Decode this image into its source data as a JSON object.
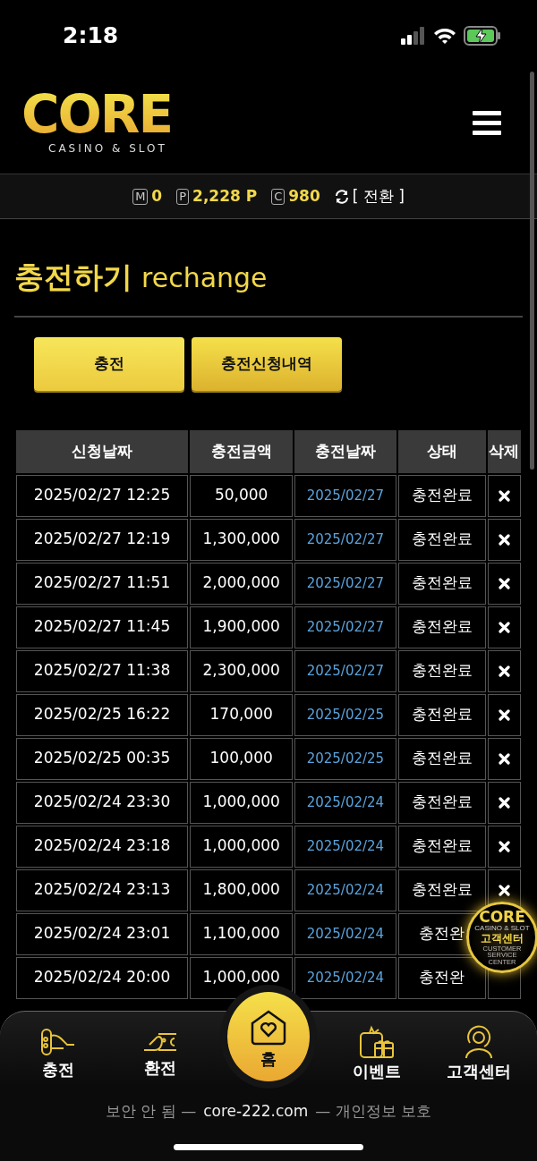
{
  "status_bar": {
    "time": "2:18"
  },
  "header": {
    "logo": {
      "name": "CORE",
      "tagline": "CASINO & SLOT"
    }
  },
  "balance": {
    "items": [
      {
        "symbol": "M",
        "value": "0"
      },
      {
        "symbol": "P",
        "value": "2,228 P"
      },
      {
        "symbol": "C",
        "value": "980"
      }
    ],
    "convert": "[ 전환 ]"
  },
  "page_title": {
    "title": "충전하기",
    "subtitle": "rechange"
  },
  "tabs": [
    {
      "label": "충전",
      "selected": false
    },
    {
      "label": "충전신청내역",
      "selected": true
    }
  ],
  "table": {
    "columns": [
      "신청날짜",
      "충전금액",
      "충전날짜",
      "상태",
      "삭제"
    ],
    "rows": [
      {
        "requested": "2025/02/27 12:25",
        "amount": "50,000",
        "charged": "2025/02/27",
        "status": "충전완료"
      },
      {
        "requested": "2025/02/27 12:19",
        "amount": "1,300,000",
        "charged": "2025/02/27",
        "status": "충전완료"
      },
      {
        "requested": "2025/02/27 11:51",
        "amount": "2,000,000",
        "charged": "2025/02/27",
        "status": "충전완료"
      },
      {
        "requested": "2025/02/27 11:45",
        "amount": "1,900,000",
        "charged": "2025/02/27",
        "status": "충전완료"
      },
      {
        "requested": "2025/02/27 11:38",
        "amount": "2,300,000",
        "charged": "2025/02/27",
        "status": "충전완료"
      },
      {
        "requested": "2025/02/25 16:22",
        "amount": "170,000",
        "charged": "2025/02/25",
        "status": "충전완료"
      },
      {
        "requested": "2025/02/25 00:35",
        "amount": "100,000",
        "charged": "2025/02/25",
        "status": "충전완료"
      },
      {
        "requested": "2025/02/24 23:30",
        "amount": "1,000,000",
        "charged": "2025/02/24",
        "status": "충전완료"
      },
      {
        "requested": "2025/02/24 23:18",
        "amount": "1,000,000",
        "charged": "2025/02/24",
        "status": "충전완료"
      },
      {
        "requested": "2025/02/24 23:13",
        "amount": "1,800,000",
        "charged": "2025/02/24",
        "status": "충전완료"
      },
      {
        "requested": "2025/02/24 23:01",
        "amount": "1,100,000",
        "charged": "2025/02/24",
        "status": "충전완"
      },
      {
        "requested": "2025/02/24 20:00",
        "amount": "1,000,000",
        "charged": "2025/02/24",
        "status": "충전완"
      }
    ]
  },
  "support_badge": {
    "logo": "CORE",
    "tagline": "CASINO & SLOT",
    "label": "고객센터",
    "caption": "CUSTOMER SERVICE CENTER"
  },
  "bottom_nav": [
    {
      "label": "충전",
      "selected": false
    },
    {
      "label": "환전",
      "selected": false
    },
    {
      "label": "홈",
      "selected": true
    },
    {
      "label": "이벤트",
      "selected": false
    },
    {
      "label": "고객센터",
      "selected": false
    }
  ],
  "browser_bar": {
    "security": "보안 안 됨 —",
    "domain": "core-222.com",
    "privacy": "— 개인정보 보호"
  }
}
